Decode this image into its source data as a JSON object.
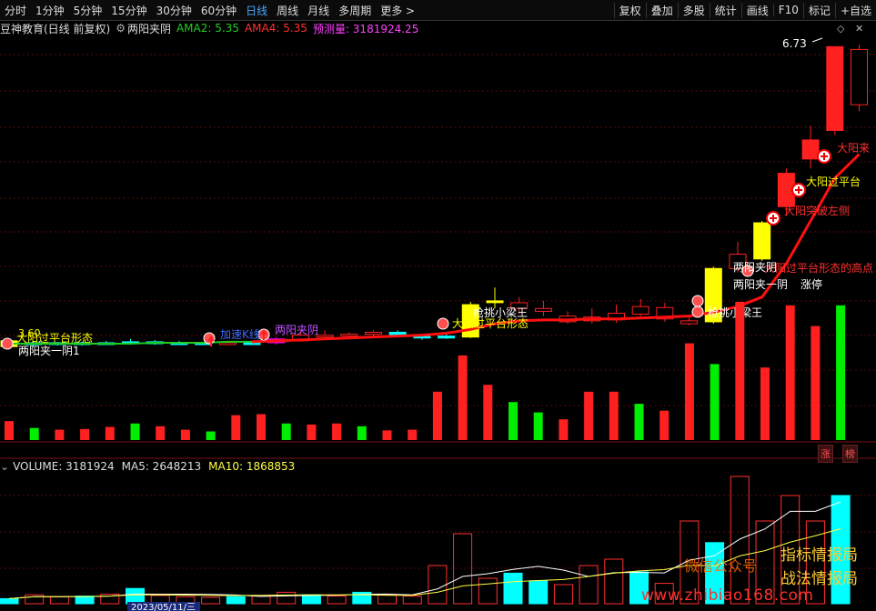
{
  "toolbar": {
    "periods": [
      "分时",
      "1分钟",
      "5分钟",
      "15分钟",
      "30分钟",
      "60分钟",
      "日线",
      "周线",
      "月线",
      "多周期",
      "更多 >"
    ],
    "active_period": "日线",
    "right_items": [
      "复权",
      "叠加",
      "多股",
      "统计",
      "画线",
      "F10",
      "标记",
      "+自选"
    ]
  },
  "info": {
    "title": "豆神教育(日线 前复权)",
    "indicator_name": "两阳夹阴",
    "ama2": "AMA2: 5.35",
    "ama4": "AMA4: 5.35",
    "forecast": "预测量: 3181924.25"
  },
  "volume_info": {
    "volume": "VOLUME: 3181924",
    "ma5": "MA5: 2648213",
    "ma10": "MA10: 1868853"
  },
  "price_high_label": "6.73",
  "left_price_label": "3.60",
  "date_label": "2023/05/11/三",
  "badges": [
    "涨",
    "榜"
  ],
  "annotations": [
    {
      "text": "大阳过平台形态",
      "color": "#ffff00"
    },
    {
      "text": "两阳夹一阴1",
      "color": "#ffffff"
    },
    {
      "text": "加速K线",
      "color": "#3a6bff"
    },
    {
      "text": "两阳夹阴",
      "color": "#c050ff"
    },
    {
      "text": "大阳过平台形态",
      "color": "#ffff00"
    },
    {
      "text": "枪挑小梁王",
      "color": "#ffffff"
    },
    {
      "text": "大阳过平台形态的高点",
      "color": "#ff3030"
    },
    {
      "text": "枪挑小梁王",
      "color": "#ffffff"
    },
    {
      "text": "两阳夹阴",
      "color": "#ffffff"
    },
    {
      "text": "涨停",
      "color": "#ffffff"
    },
    {
      "text": "两阳夹一阴",
      "color": "#ffffff"
    },
    {
      "text": "大阳突破左侧",
      "color": "#ff3030"
    },
    {
      "text": "大阳过平台",
      "color": "#ffff00"
    },
    {
      "text": "大阳来",
      "color": "#ff3030"
    }
  ],
  "watermark": {
    "line1": "微信公众号",
    "line2a": "指标情报局",
    "line2b": "战法情报局",
    "url": "www.zhibiao168.com"
  },
  "colors": {
    "up": "#ff2020",
    "down": "#00ffff",
    "yellow": "#ffff00",
    "magenta": "#ff00ff",
    "green": "#00ee00",
    "ma_red": "#ff1010",
    "ma_green": "#22cc22"
  },
  "chart_data": {
    "type": "candlestick",
    "candles": [
      {
        "o": 3.58,
        "c": 3.64,
        "h": 3.66,
        "l": 3.55,
        "k": "yellow"
      },
      {
        "o": 3.62,
        "c": 3.6,
        "h": 3.64,
        "l": 3.58,
        "k": "down"
      },
      {
        "o": 3.61,
        "c": 3.62,
        "h": 3.63,
        "l": 3.59,
        "k": "down"
      },
      {
        "o": 3.62,
        "c": 3.61,
        "h": 3.63,
        "l": 3.59,
        "k": "down"
      },
      {
        "o": 3.61,
        "c": 3.62,
        "h": 3.64,
        "l": 3.6,
        "k": "down"
      },
      {
        "o": 3.63,
        "c": 3.62,
        "h": 3.66,
        "l": 3.6,
        "k": "down"
      },
      {
        "o": 3.63,
        "c": 3.61,
        "h": 3.65,
        "l": 3.6,
        "k": "down"
      },
      {
        "o": 3.62,
        "c": 3.61,
        "h": 3.64,
        "l": 3.6,
        "k": "down"
      },
      {
        "o": 3.61,
        "c": 3.62,
        "h": 3.63,
        "l": 3.6,
        "k": "down"
      },
      {
        "o": 3.62,
        "c": 3.61,
        "h": 3.64,
        "l": 3.6,
        "k": "up"
      },
      {
        "o": 3.61,
        "c": 3.62,
        "h": 3.63,
        "l": 3.6,
        "k": "down"
      },
      {
        "o": 3.62,
        "c": 3.66,
        "h": 3.68,
        "l": 3.6,
        "k": "magenta"
      },
      {
        "o": 3.64,
        "c": 3.7,
        "h": 3.74,
        "l": 3.63,
        "k": "up"
      },
      {
        "o": 3.69,
        "c": 3.7,
        "h": 3.75,
        "l": 3.67,
        "k": "up"
      },
      {
        "o": 3.7,
        "c": 3.71,
        "h": 3.73,
        "l": 3.68,
        "k": "up"
      },
      {
        "o": 3.71,
        "c": 3.73,
        "h": 3.75,
        "l": 3.69,
        "k": "up"
      },
      {
        "o": 3.73,
        "c": 3.69,
        "h": 3.75,
        "l": 3.68,
        "k": "down"
      },
      {
        "o": 3.69,
        "c": 3.67,
        "h": 3.71,
        "l": 3.65,
        "k": "down"
      },
      {
        "o": 3.67,
        "c": 3.69,
        "h": 3.72,
        "l": 3.66,
        "k": "down"
      },
      {
        "o": 3.68,
        "c": 4.02,
        "h": 4.05,
        "l": 3.67,
        "k": "yellow"
      },
      {
        "o": 4.06,
        "c": 4.06,
        "h": 4.2,
        "l": 3.98,
        "k": "yellow"
      },
      {
        "o": 4.04,
        "c": 3.98,
        "h": 4.1,
        "l": 3.92,
        "k": "up"
      },
      {
        "o": 3.98,
        "c": 3.95,
        "h": 4.06,
        "l": 3.9,
        "k": "up"
      },
      {
        "o": 3.9,
        "c": 3.84,
        "h": 3.95,
        "l": 3.82,
        "k": "up"
      },
      {
        "o": 3.85,
        "c": 3.89,
        "h": 3.98,
        "l": 3.82,
        "k": "up"
      },
      {
        "o": 3.86,
        "c": 3.93,
        "h": 4.02,
        "l": 3.83,
        "k": "up"
      },
      {
        "o": 3.92,
        "c": 4.0,
        "h": 4.08,
        "l": 3.9,
        "k": "up"
      },
      {
        "o": 3.87,
        "c": 3.99,
        "h": 4.04,
        "l": 3.84,
        "k": "up"
      },
      {
        "o": 3.85,
        "c": 3.82,
        "h": 3.9,
        "l": 3.8,
        "k": "up"
      },
      {
        "o": 3.84,
        "c": 4.4,
        "h": 4.42,
        "l": 3.82,
        "k": "yellow"
      },
      {
        "o": 4.4,
        "c": 4.55,
        "h": 4.68,
        "l": 4.36,
        "k": "up"
      },
      {
        "o": 4.5,
        "c": 4.88,
        "h": 4.9,
        "l": 4.48,
        "k": "yellow"
      },
      {
        "o": 5.05,
        "c": 5.4,
        "h": 5.45,
        "l": 4.95,
        "k": "upfill"
      },
      {
        "o": 5.55,
        "c": 5.75,
        "h": 5.9,
        "l": 5.45,
        "k": "upfill"
      },
      {
        "o": 5.85,
        "c": 6.73,
        "h": 6.73,
        "l": 5.8,
        "k": "upfill"
      },
      {
        "o": 6.7,
        "c": 6.12,
        "h": 6.75,
        "l": 6.05,
        "k": "up"
      }
    ],
    "volumes": [
      {
        "v": 0.55,
        "k": "up"
      },
      {
        "v": 0.35,
        "k": "g"
      },
      {
        "v": 0.3,
        "k": "up"
      },
      {
        "v": 0.32,
        "k": "up"
      },
      {
        "v": 0.38,
        "k": "up"
      },
      {
        "v": 0.48,
        "k": "g"
      },
      {
        "v": 0.4,
        "k": "up"
      },
      {
        "v": 0.3,
        "k": "up"
      },
      {
        "v": 0.25,
        "k": "g"
      },
      {
        "v": 0.72,
        "k": "up"
      },
      {
        "v": 0.75,
        "k": "up"
      },
      {
        "v": 0.48,
        "k": "g"
      },
      {
        "v": 0.45,
        "k": "up"
      },
      {
        "v": 0.48,
        "k": "up"
      },
      {
        "v": 0.4,
        "k": "g"
      },
      {
        "v": 0.28,
        "k": "up"
      },
      {
        "v": 0.3,
        "k": "up"
      },
      {
        "v": 1.4,
        "k": "up"
      },
      {
        "v": 2.45,
        "k": "up"
      },
      {
        "v": 1.6,
        "k": "up"
      },
      {
        "v": 1.1,
        "k": "g"
      },
      {
        "v": 0.8,
        "k": "g"
      },
      {
        "v": 0.6,
        "k": "up"
      },
      {
        "v": 1.4,
        "k": "up"
      },
      {
        "v": 1.4,
        "k": "up"
      },
      {
        "v": 1.05,
        "k": "g"
      },
      {
        "v": 0.85,
        "k": "up"
      },
      {
        "v": 2.8,
        "k": "up"
      },
      {
        "v": 2.2,
        "k": "g"
      },
      {
        "v": 4.0,
        "k": "up"
      },
      {
        "v": 2.1,
        "k": "up"
      },
      {
        "v": 3.9,
        "k": "up"
      },
      {
        "v": 3.3,
        "k": "up"
      },
      {
        "v": 3.9,
        "k": "g"
      }
    ],
    "ma_line": [
      3.61,
      3.61,
      3.61,
      3.61,
      3.61,
      3.61,
      3.62,
      3.62,
      3.62,
      3.63,
      3.63,
      3.64,
      3.65,
      3.66,
      3.67,
      3.68,
      3.69,
      3.7,
      3.72,
      3.76,
      3.82,
      3.85,
      3.86,
      3.86,
      3.87,
      3.87,
      3.88,
      3.89,
      3.9,
      3.94,
      4.0,
      4.1,
      4.45,
      4.9,
      5.35,
      5.6
    ],
    "lower_volumes": [
      {
        "v": 0.4,
        "k": "down"
      },
      {
        "v": 0.7,
        "k": "up"
      },
      {
        "v": 0.55,
        "k": "up"
      },
      {
        "v": 0.6,
        "k": "down"
      },
      {
        "v": 0.75,
        "k": "up"
      },
      {
        "v": 1.2,
        "k": "down"
      },
      {
        "v": 0.65,
        "k": "up"
      },
      {
        "v": 0.55,
        "k": "up"
      },
      {
        "v": 0.5,
        "k": "up"
      },
      {
        "v": 0.55,
        "k": "down"
      },
      {
        "v": 0.6,
        "k": "up"
      },
      {
        "v": 0.9,
        "k": "up"
      },
      {
        "v": 0.7,
        "k": "down"
      },
      {
        "v": 0.6,
        "k": "up"
      },
      {
        "v": 0.9,
        "k": "down"
      },
      {
        "v": 0.7,
        "k": "up"
      },
      {
        "v": 0.6,
        "k": "up"
      },
      {
        "v": 3.0,
        "k": "up"
      },
      {
        "v": 5.5,
        "k": "up"
      },
      {
        "v": 2.0,
        "k": "up"
      },
      {
        "v": 2.4,
        "k": "down"
      },
      {
        "v": 1.8,
        "k": "down"
      },
      {
        "v": 1.5,
        "k": "up"
      },
      {
        "v": 3.0,
        "k": "up"
      },
      {
        "v": 3.5,
        "k": "up"
      },
      {
        "v": 2.5,
        "k": "down"
      },
      {
        "v": 1.6,
        "k": "up"
      },
      {
        "v": 6.5,
        "k": "up"
      },
      {
        "v": 4.8,
        "k": "down"
      },
      {
        "v": 10.0,
        "k": "up"
      },
      {
        "v": 6.5,
        "k": "up"
      },
      {
        "v": 8.5,
        "k": "up"
      },
      {
        "v": 6.5,
        "k": "up"
      },
      {
        "v": 8.5,
        "k": "down"
      }
    ]
  }
}
